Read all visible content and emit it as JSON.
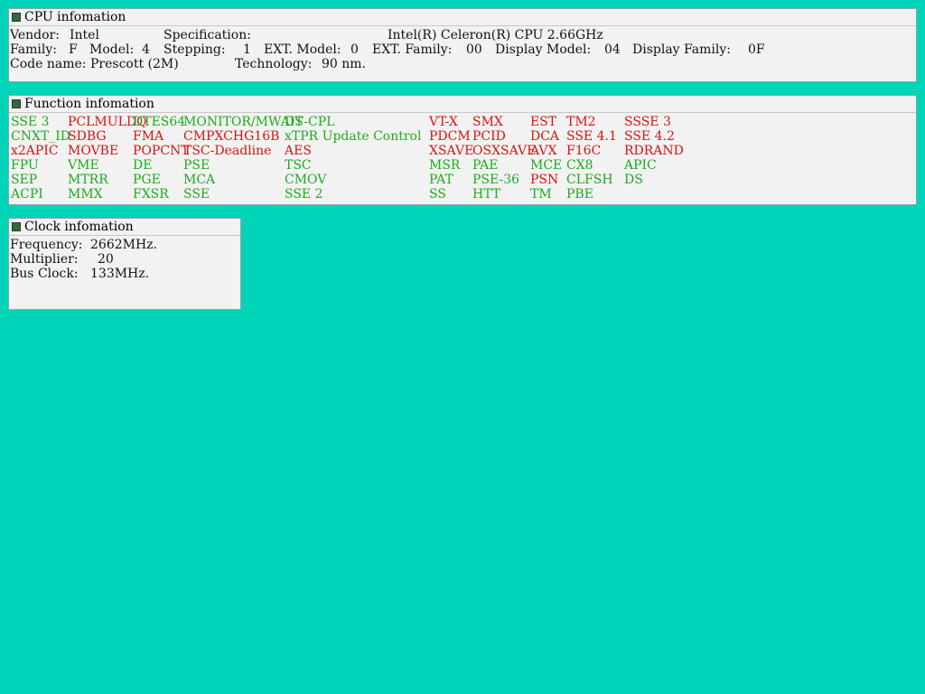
{
  "cpu": {
    "title": "CPU infomation",
    "vendor_label": "Vendor:",
    "vendor": "Intel",
    "spec_label": "Specification:",
    "spec": "Intel(R) Celeron(R) CPU 2.66GHz",
    "family_label": "Family:",
    "family": "F",
    "model_label": "Model:",
    "model": "4",
    "stepping_label": "Stepping:",
    "stepping": "1",
    "ext_model_label": "EXT. Model:",
    "ext_model": "0",
    "ext_family_label": "EXT. Family:",
    "ext_family": "00",
    "display_model_label": "Display Model:",
    "display_model": "04",
    "display_family_label": "Display Family:",
    "display_family": "0F",
    "code_name_label": "Code name:",
    "code_name": "Prescott (2M)",
    "technology_label": "Technology:",
    "technology": "90 nm."
  },
  "functions": {
    "title": "Function infomation",
    "colors": {
      "supported": "#1cab1c",
      "unsupported": "#dd1111"
    },
    "rows": [
      [
        {
          "name": "SSE 3",
          "supported": true
        },
        {
          "name": "PCLMULDQ",
          "supported": false
        },
        {
          "name": "DTES64",
          "supported": true
        },
        {
          "name": "MONITOR/MWAIT",
          "supported": true
        },
        {
          "name": "DS-CPL",
          "supported": true
        },
        {
          "name": "VT-X",
          "supported": false
        },
        {
          "name": "SMX",
          "supported": false
        },
        {
          "name": "EST",
          "supported": false
        },
        {
          "name": "TM2",
          "supported": false
        },
        {
          "name": "SSSE 3",
          "supported": false
        }
      ],
      [
        {
          "name": "CNXT_ID",
          "supported": true
        },
        {
          "name": "SDBG",
          "supported": false
        },
        {
          "name": "FMA",
          "supported": false
        },
        {
          "name": "CMPXCHG16B",
          "supported": false
        },
        {
          "name": "xTPR Update Control",
          "supported": true
        },
        {
          "name": "PDCM",
          "supported": false
        },
        {
          "name": "PCID",
          "supported": false
        },
        {
          "name": "DCA",
          "supported": false
        },
        {
          "name": "SSE 4.1",
          "supported": false
        },
        {
          "name": "SSE 4.2",
          "supported": false
        }
      ],
      [
        {
          "name": "x2APIC",
          "supported": false
        },
        {
          "name": "MOVBE",
          "supported": false
        },
        {
          "name": "POPCNT",
          "supported": false
        },
        {
          "name": "TSC-Deadline",
          "supported": false
        },
        {
          "name": "AES",
          "supported": false
        },
        {
          "name": "XSAVE",
          "supported": false
        },
        {
          "name": "OSXSAVE",
          "supported": false
        },
        {
          "name": "AVX",
          "supported": false
        },
        {
          "name": "F16C",
          "supported": false
        },
        {
          "name": "RDRAND",
          "supported": false
        }
      ],
      [
        {
          "name": "FPU",
          "supported": true
        },
        {
          "name": "VME",
          "supported": true
        },
        {
          "name": "DE",
          "supported": true
        },
        {
          "name": "PSE",
          "supported": true
        },
        {
          "name": "TSC",
          "supported": true
        },
        {
          "name": "MSR",
          "supported": true
        },
        {
          "name": "PAE",
          "supported": true
        },
        {
          "name": "MCE",
          "supported": true
        },
        {
          "name": "CX8",
          "supported": true
        },
        {
          "name": "APIC",
          "supported": true
        }
      ],
      [
        {
          "name": "SEP",
          "supported": true
        },
        {
          "name": "MTRR",
          "supported": true
        },
        {
          "name": "PGE",
          "supported": true
        },
        {
          "name": "MCA",
          "supported": true
        },
        {
          "name": "CMOV",
          "supported": true
        },
        {
          "name": "PAT",
          "supported": true
        },
        {
          "name": "PSE-36",
          "supported": true
        },
        {
          "name": "PSN",
          "supported": false
        },
        {
          "name": "CLFSH",
          "supported": true
        },
        {
          "name": "DS",
          "supported": true
        }
      ],
      [
        {
          "name": "ACPI",
          "supported": true
        },
        {
          "name": "MMX",
          "supported": true
        },
        {
          "name": "FXSR",
          "supported": true
        },
        {
          "name": "SSE",
          "supported": true
        },
        {
          "name": "SSE 2",
          "supported": true
        },
        {
          "name": "SS",
          "supported": true
        },
        {
          "name": "HTT",
          "supported": true
        },
        {
          "name": "TM",
          "supported": true
        },
        {
          "name": "PBE",
          "supported": true
        },
        {
          "name": "",
          "supported": true
        }
      ]
    ]
  },
  "clock": {
    "title": "Clock infomation",
    "frequency_label": "Frequency:",
    "frequency": "2662MHz.",
    "multiplier_label": "Multiplier:",
    "multiplier": "20",
    "bus_clock_label": "Bus Clock:",
    "bus_clock": "133MHz."
  }
}
